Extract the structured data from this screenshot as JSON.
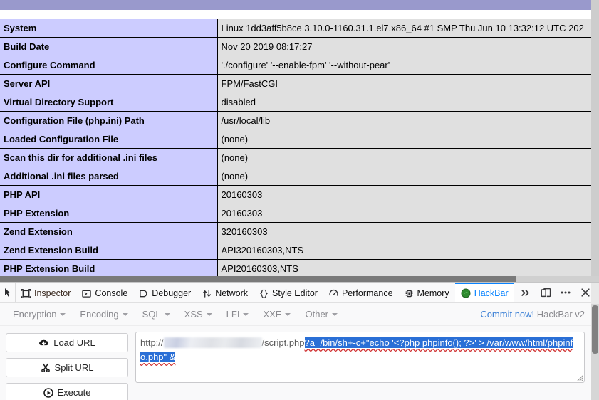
{
  "phpinfo": {
    "rows": [
      {
        "key": "System",
        "value": "Linux 1dd3aff5b8ce 3.10.0-1160.31.1.el7.x86_64 #1 SMP Thu Jun 10 13:32:12 UTC 202"
      },
      {
        "key": "Build Date",
        "value": "Nov 20 2019 08:17:27"
      },
      {
        "key": "Configure Command",
        "value": "'./configure' '--enable-fpm' '--without-pear'"
      },
      {
        "key": "Server API",
        "value": "FPM/FastCGI"
      },
      {
        "key": "Virtual Directory Support",
        "value": "disabled"
      },
      {
        "key": "Configuration File (php.ini) Path",
        "value": "/usr/local/lib"
      },
      {
        "key": "Loaded Configuration File",
        "value": "(none)"
      },
      {
        "key": "Scan this dir for additional .ini files",
        "value": "(none)"
      },
      {
        "key": "Additional .ini files parsed",
        "value": "(none)"
      },
      {
        "key": "PHP API",
        "value": "20160303"
      },
      {
        "key": "PHP Extension",
        "value": "20160303"
      },
      {
        "key": "Zend Extension",
        "value": "320160303"
      },
      {
        "key": "Zend Extension Build",
        "value": "API320160303,NTS"
      },
      {
        "key": "PHP Extension Build",
        "value": "API20160303,NTS"
      }
    ],
    "colors": {
      "header_band": "#9999cc",
      "key_cell": "#ccccff",
      "value_cell": "#e0e0e0",
      "border": "#000000"
    }
  },
  "devtools": {
    "picker_icon": "element-picker-icon",
    "tabs": [
      {
        "label": "Inspector",
        "icon": "inspector-icon",
        "active": false
      },
      {
        "label": "Console",
        "icon": "console-icon",
        "active": false
      },
      {
        "label": "Debugger",
        "icon": "debugger-icon",
        "active": false
      },
      {
        "label": "Network",
        "icon": "network-icon",
        "active": false
      },
      {
        "label": "Style Editor",
        "icon": "style-editor-icon",
        "active": false
      },
      {
        "label": "Performance",
        "icon": "performance-icon",
        "active": false
      },
      {
        "label": "Memory",
        "icon": "memory-icon",
        "active": false
      },
      {
        "label": "HackBar",
        "icon": "hackbar-icon",
        "active": true
      }
    ],
    "right_controls": [
      {
        "name": "overflow-chevrons-icon",
        "glyph": "»"
      },
      {
        "name": "responsive-design-mode-icon",
        "glyph": ""
      },
      {
        "name": "devtools-menu-icon",
        "glyph": "•••"
      },
      {
        "name": "close-devtools-icon",
        "glyph": "✕"
      }
    ],
    "active_tab_accent": "#0a84ff"
  },
  "hackbar": {
    "menus": [
      {
        "label": "Encryption"
      },
      {
        "label": "Encoding"
      },
      {
        "label": "SQL"
      },
      {
        "label": "XSS"
      },
      {
        "label": "LFI"
      },
      {
        "label": "XXE"
      },
      {
        "label": "Other"
      }
    ],
    "commit": {
      "link_text": "Commit now!",
      "version_text": "HackBar v2"
    },
    "buttons": [
      {
        "label": "Load URL",
        "icon": "cloud-download-icon"
      },
      {
        "label": "Split URL",
        "icon": "scissors-icon"
      },
      {
        "label": "Execute",
        "icon": "play-icon"
      }
    ],
    "url_field": {
      "prefix": "http://",
      "host_redacted": true,
      "path": "/script.php",
      "selected_text": "?a=/bin/sh+-c+\"echo '<?php phpinfo(); ?>' > /var/www/html/phpinfo.php\" &",
      "selection_color": "#2a6fd6"
    }
  }
}
